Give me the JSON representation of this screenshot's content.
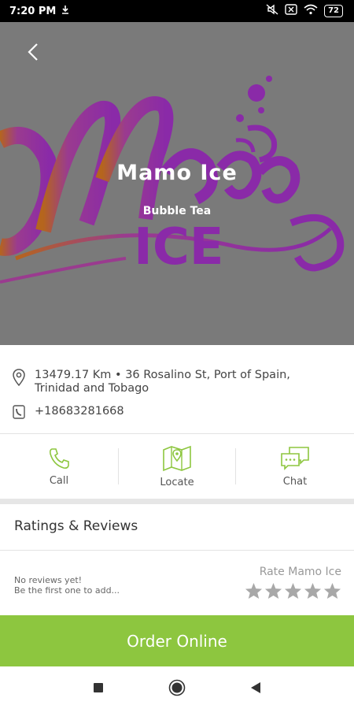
{
  "status_bar": {
    "time": "7:20 PM",
    "battery": "72"
  },
  "hero": {
    "title": "Mamo Ice",
    "subtitle": "Bubble Tea",
    "logo_text_top": "Mamo",
    "logo_text_bottom": "ICE"
  },
  "info": {
    "address": "13479.17 Km  •  36 Rosalino St, Port of Spain, Trinidad and Tobago",
    "phone": "+18683281668"
  },
  "actions": [
    {
      "label": "Call",
      "icon": "phone-icon"
    },
    {
      "label": "Locate",
      "icon": "map-icon"
    },
    {
      "label": "Chat",
      "icon": "chat-icon"
    }
  ],
  "ratings": {
    "header": "Ratings & Reviews",
    "no_reviews_line1": "No reviews yet!",
    "no_reviews_line2": "Be the first one to add...",
    "rate_label": "Rate Mamo Ice",
    "star_count": 5
  },
  "order": {
    "label": "Order Online"
  },
  "colors": {
    "accent": "#8dc63f",
    "hero_bg": "#7a7a7a",
    "logo_purple": "#8a2aa8",
    "logo_orange": "#b5651d"
  }
}
